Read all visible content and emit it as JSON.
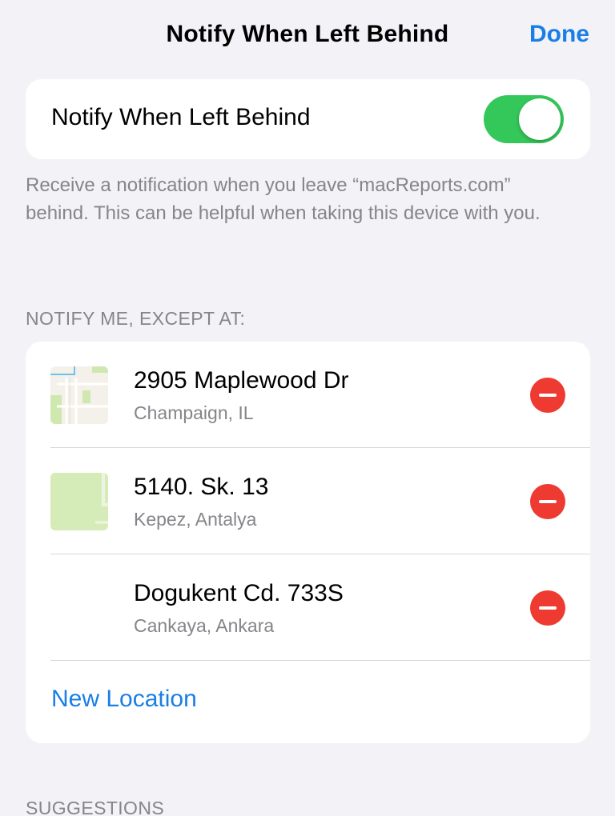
{
  "nav": {
    "title": "Notify When Left Behind",
    "done_label": "Done"
  },
  "toggle": {
    "label": "Notify When Left Behind",
    "state": "on"
  },
  "description": "Receive a notification when you leave “macReports.com” behind. This can be helpful when taking this device with you.",
  "except_header": "NOTIFY ME, EXCEPT AT:",
  "locations": [
    {
      "title": "2905 Maplewood Dr",
      "subtitle": "Champaign, IL",
      "thumbnail": "map-thumbnail"
    },
    {
      "title": "5140. Sk. 13",
      "subtitle": "Kepez, Antalya",
      "thumbnail": "map-thumbnail"
    },
    {
      "title": "Dogukent Cd. 733S",
      "subtitle": "Cankaya, Ankara",
      "thumbnail": "none"
    }
  ],
  "new_location_label": "New Location",
  "suggestions_header": "SUGGESTIONS",
  "colors": {
    "accent": "#1a7ee6",
    "switch_on": "#34c759",
    "remove": "#ee3a30",
    "background": "#f2f2f7",
    "secondary_text": "#85858a"
  },
  "icons": {
    "remove": "minus-circle-icon"
  }
}
